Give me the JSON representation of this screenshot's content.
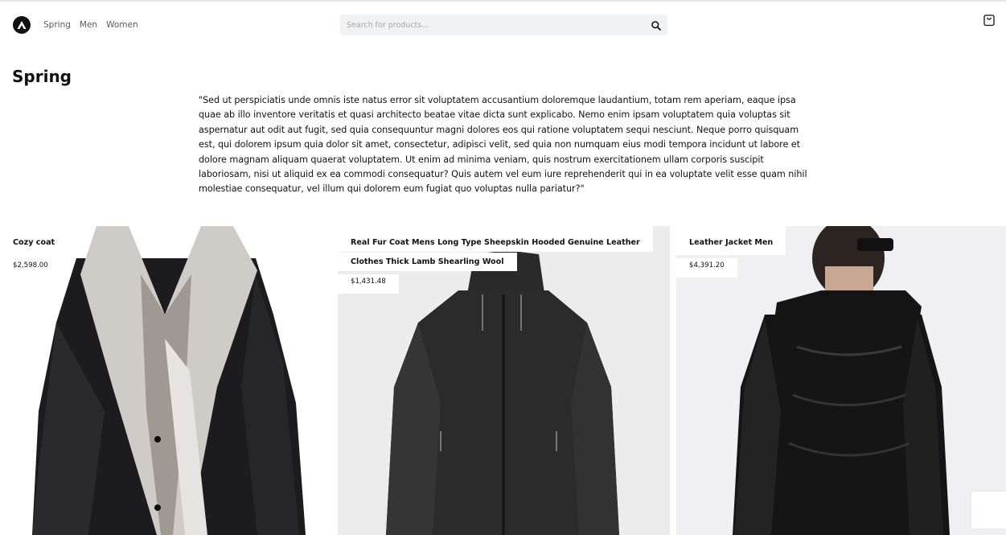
{
  "header": {
    "logo_icon": "triangle-logo-icon",
    "nav": [
      {
        "label": "Spring"
      },
      {
        "label": "Men"
      },
      {
        "label": "Women"
      }
    ],
    "search": {
      "placeholder": "Search for products...",
      "value": "",
      "icon": "search-icon"
    },
    "cart_icon": "shopping-bag-icon"
  },
  "page": {
    "title": "Spring",
    "description": "\"Sed ut perspiciatis unde omnis iste natus error sit voluptatem accusantium doloremque laudantium, totam rem aperiam, eaque ipsa quae ab illo inventore veritatis et quasi architecto beatae vitae dicta sunt explicabo. Nemo enim ipsam voluptatem quia voluptas sit aspernatur aut odit aut fugit, sed quia consequuntur magni dolores eos qui ratione voluptatem sequi nesciunt. Neque porro quisquam est, qui dolorem ipsum quia dolor sit amet, consectetur, adipisci velit, sed quia non numquam eius modi tempora incidunt ut labore et dolore magnam aliquam quaerat voluptatem. Ut enim ad minima veniam, quis nostrum exercitationem ullam corporis suscipit laboriosam, nisi ut aliquid ex ea commodi consequatur? Quis autem vel eum iure reprehenderit qui in ea voluptate velit esse quam nihil molestiae consequatur, vel illum qui dolorem eum fugiat quo voluptas nulla pariatur?\""
  },
  "products": [
    {
      "name": "Cozy coat",
      "price": "$2,598.00"
    },
    {
      "name_line1": "Real Fur Coat Mens Long Type Sheepskin Hooded Genuine Leather",
      "name_line2": "Clothes Thick Lamb Shearling Wool",
      "price": "$1,431.48"
    },
    {
      "name": "Leather Jacket Men",
      "price": "$4,391.20"
    }
  ]
}
